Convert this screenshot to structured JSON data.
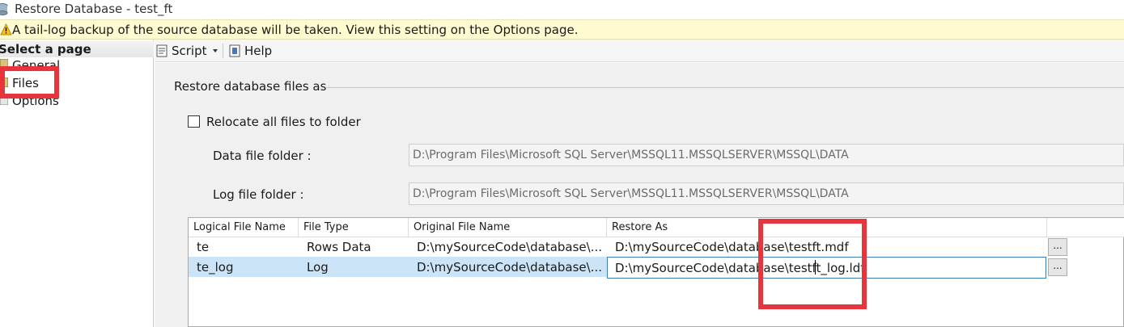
{
  "window": {
    "title": "Restore Database - test_ft"
  },
  "warning": {
    "text": "A tail-log backup of the source database will be taken. View this setting on the Options page."
  },
  "left_pane": {
    "header": "Select a page",
    "items": [
      {
        "label": "General"
      },
      {
        "label": "Files"
      },
      {
        "label": "Options"
      }
    ]
  },
  "toolbar": {
    "script_label": "Script",
    "help_label": "Help"
  },
  "section": {
    "title": "Restore database files as"
  },
  "relocate": {
    "label": "Relocate all files to folder",
    "checked": false
  },
  "data_folder": {
    "label": "Data file folder :",
    "value": "D:\\Program Files\\Microsoft SQL Server\\MSSQL11.MSSQLSERVER\\MSSQL\\DATA"
  },
  "log_folder": {
    "label": "Log file folder :",
    "value": "D:\\Program Files\\Microsoft SQL Server\\MSSQL11.MSSQLSERVER\\MSSQL\\DATA"
  },
  "table": {
    "headers": [
      "Logical File Name",
      "File Type",
      "Original File Name",
      "Restore As"
    ],
    "rows": [
      {
        "logical": "te",
        "type": "Rows Data",
        "original": "D:\\mySourceCode\\database\\...",
        "restore_as": "D:\\mySourceCode\\database\\testft.mdf",
        "browse": "..."
      },
      {
        "logical": "te_log",
        "type": "Log",
        "original": "D:\\mySourceCode\\database\\...",
        "restore_as": "D:\\mySourceCode\\database\\testft_log.ldf",
        "browse": "..."
      }
    ]
  },
  "colors": {
    "highlight": "#e8343b",
    "warning_bg": "#fffbd0",
    "selection": "#cce4f7"
  }
}
